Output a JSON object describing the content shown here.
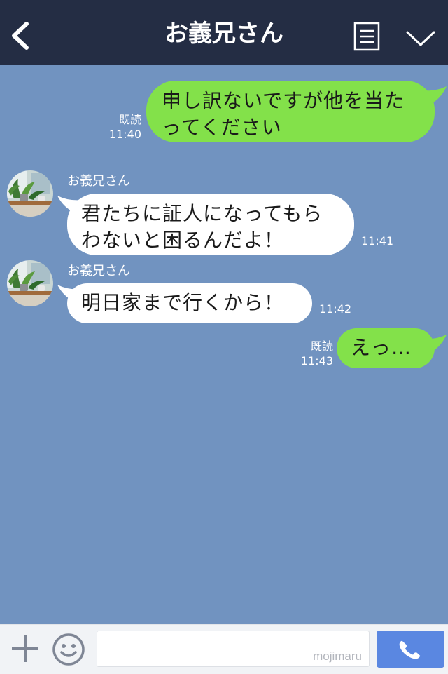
{
  "header": {
    "title": "お義兄さん",
    "icons": {
      "back": "chevron-left-icon",
      "menu": "menu-icon",
      "collapse": "chevron-down-icon"
    }
  },
  "messages": [
    {
      "from": "me",
      "text": "申し訳ないですが他を当た\nってください",
      "read": "既読",
      "time": "11:40"
    },
    {
      "from": "them",
      "sender": "お義兄さん",
      "text": "君たちに証人になってもら\nわないと困るんだよ！",
      "time": "11:41"
    },
    {
      "from": "them",
      "sender": "お義兄さん",
      "text": "明日家まで行くから！",
      "time": "11:42"
    },
    {
      "from": "me",
      "text": "えっ…",
      "read": "既読",
      "time": "11:43"
    }
  ],
  "input_bar": {
    "watermark": "mojimaru",
    "icons": {
      "add": "plus-icon",
      "emoji": "smiley-icon",
      "call": "phone-icon"
    }
  },
  "colors": {
    "header_bg": "#242d44",
    "chat_bg": "#7193c0",
    "my_bubble": "#83e14a",
    "their_bubble": "#ffffff",
    "call_button": "#5a87e1"
  }
}
